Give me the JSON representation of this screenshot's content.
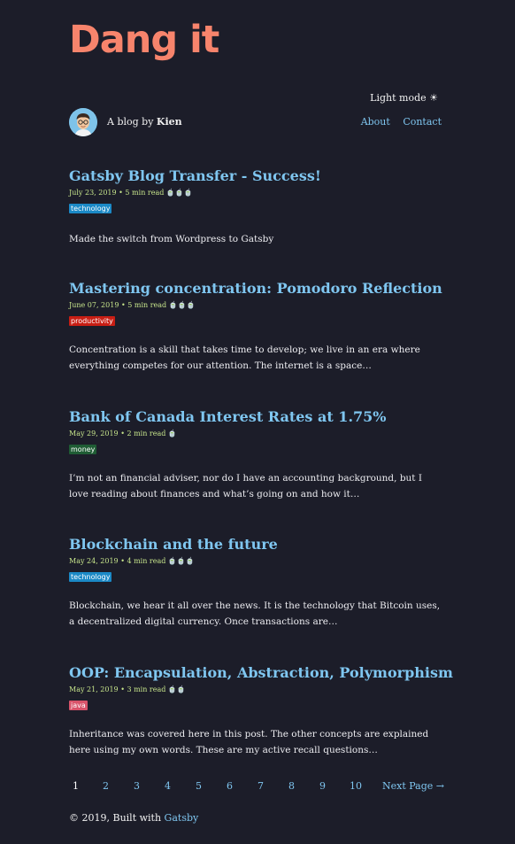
{
  "site": {
    "title": "Dang it",
    "theme_toggle": "Light mode ☀",
    "byline_prefix": "A blog by ",
    "byline_author": "Kien"
  },
  "nav": [
    {
      "label": "About"
    },
    {
      "label": "Contact"
    }
  ],
  "posts": [
    {
      "title": "Gatsby Blog Transfer - Success!",
      "meta": "July 23, 2019 • 5 min read 🍵🍵🍵",
      "tag": "technology",
      "tag_color": "#1b89c6",
      "excerpt": "Made the switch from Wordpress to Gatsby"
    },
    {
      "title": "Mastering concentration: Pomodoro Reflection",
      "meta": "June 07, 2019 • 5 min read 🍵🍵🍵",
      "tag": "productivity",
      "tag_color": "#c81e14",
      "excerpt": "Concentration is a skill that takes time to develop; we live in an era where everything competes for our attention. The internet is a space…"
    },
    {
      "title": "Bank of Canada Interest Rates at 1.75%",
      "meta": "May 29, 2019 • 2 min read 🍵",
      "tag": "money",
      "tag_color": "#1f5c34",
      "excerpt": "I’m not an financial adviser, nor do I have an accounting background, but I love reading about finances and what’s going on and how it…"
    },
    {
      "title": "Blockchain and the future",
      "meta": "May 24, 2019 • 4 min read 🍵🍵🍵",
      "tag": "technology",
      "tag_color": "#1b89c6",
      "excerpt": "Blockchain, we hear it all over the news. It is the technology that Bitcoin uses, a decentralized digital currency. Once transactions are…"
    },
    {
      "title": "OOP: Encapsulation, Abstraction, Polymorphism",
      "meta": "May 21, 2019 • 3 min read 🍵🍵",
      "tag": "java",
      "tag_color": "#d8536a",
      "excerpt": "Inheritance was covered here in this post. The other concepts are explained here using my own words. These are my active recall questions…"
    }
  ],
  "pagination": {
    "pages": [
      "1",
      "2",
      "3",
      "4",
      "5",
      "6",
      "7",
      "8",
      "9",
      "10"
    ],
    "current": "1",
    "next_label": "Next Page →"
  },
  "footer": {
    "prefix": "© 2019, Built with ",
    "link": "Gatsby"
  },
  "colors": {
    "background": "#1c1d29",
    "brand": "#f7846c",
    "link": "#7fc6f0",
    "meta": "#c6e48b"
  }
}
